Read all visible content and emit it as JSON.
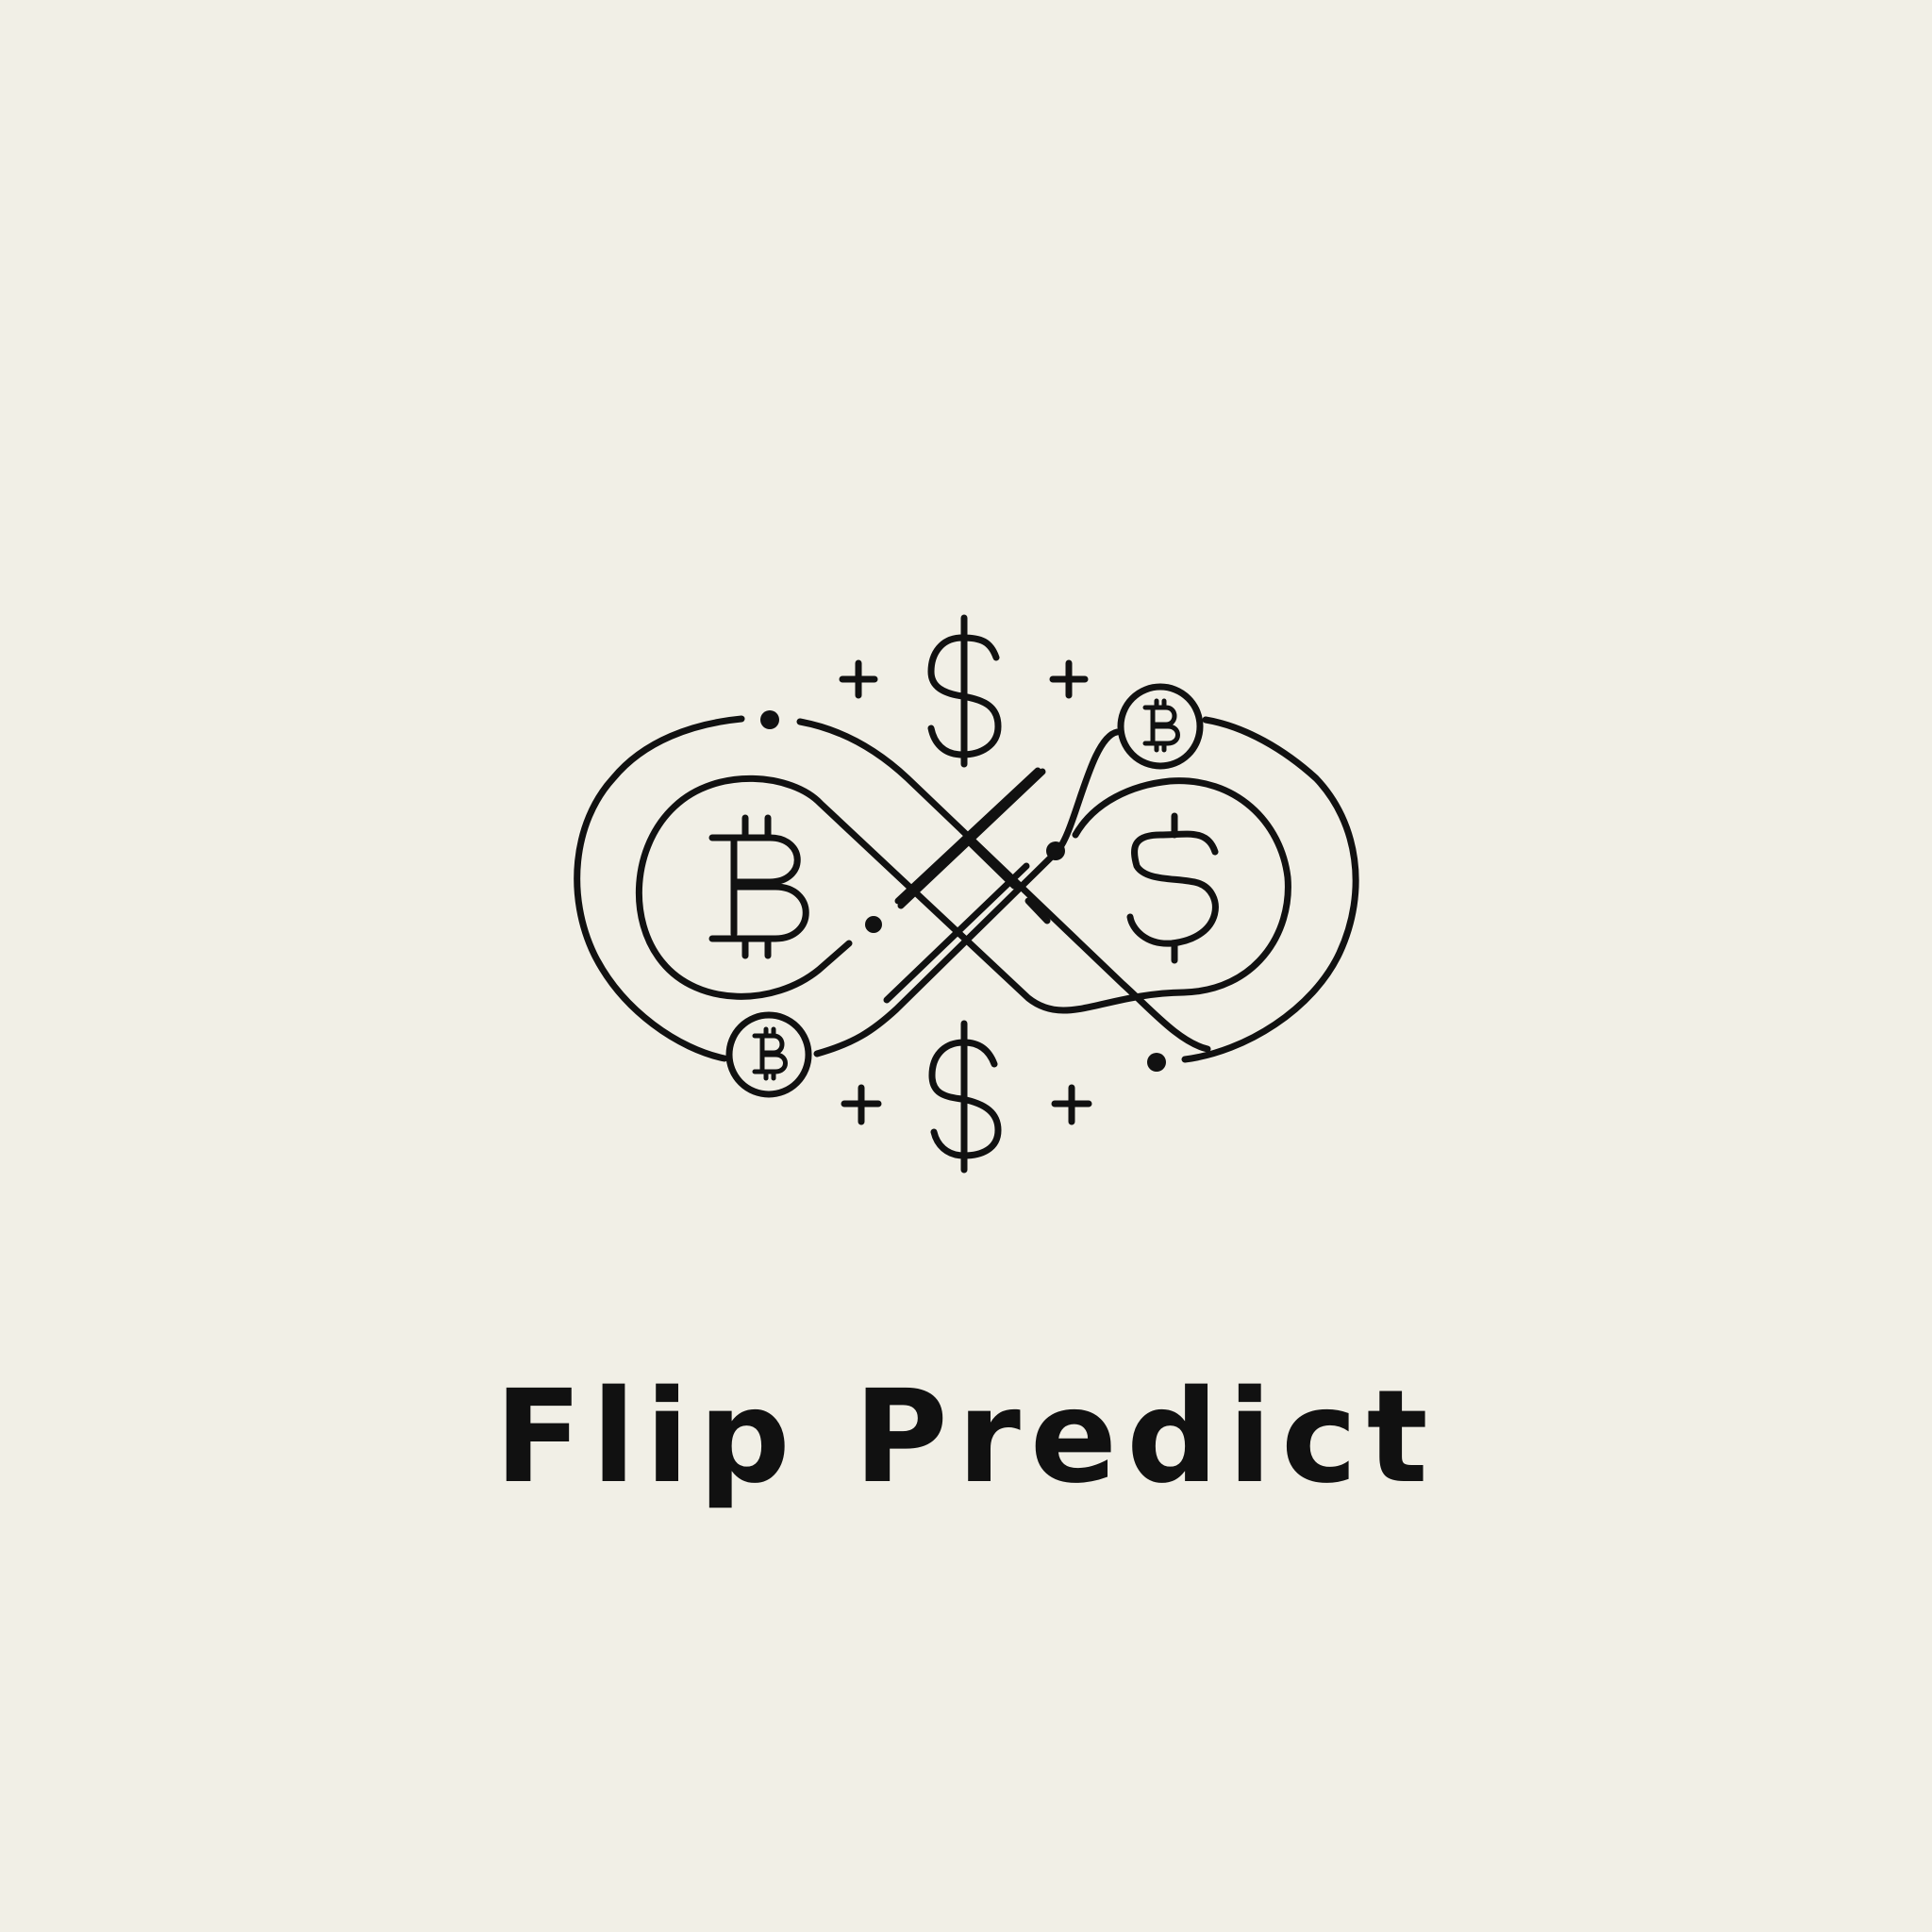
{
  "brand": {
    "name": "Flip Predict"
  },
  "colors": {
    "background": "#f1efe6",
    "ink": "#111111"
  },
  "icons": {
    "mark": "infinity-currency-logo",
    "left_symbol": "bitcoin-icon",
    "right_symbol": "dollar-icon"
  }
}
